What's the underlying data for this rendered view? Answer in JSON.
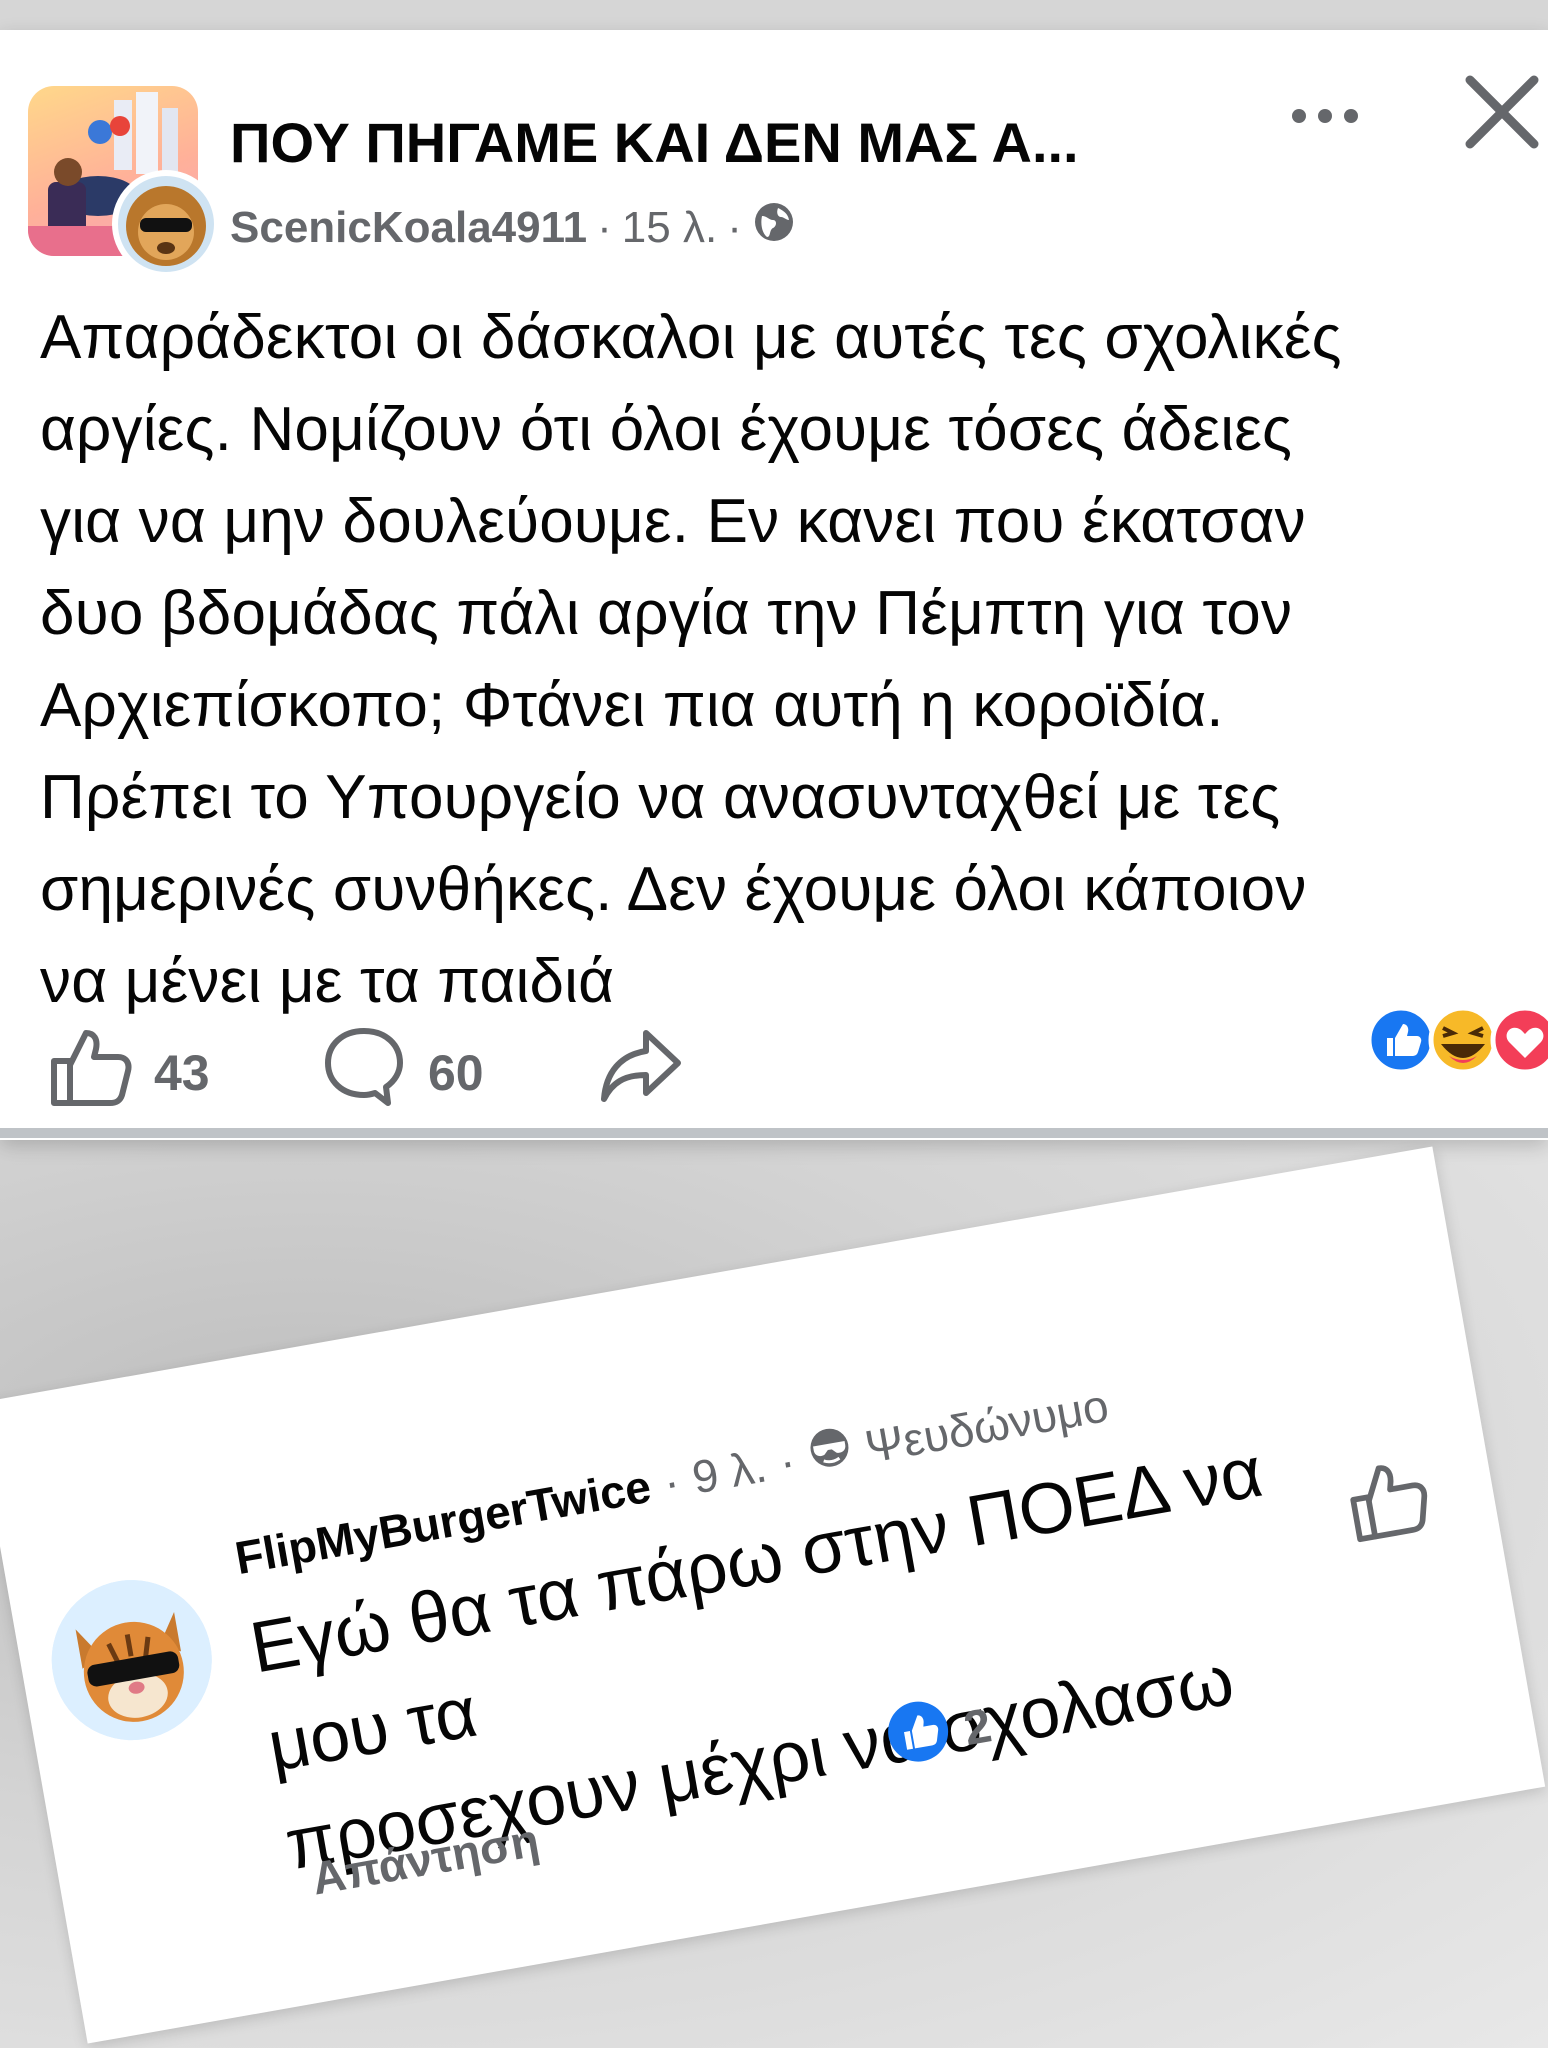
{
  "post": {
    "group_title": "ΠΟΥ ΠΗΓΑΜΕ ΚΑΙ ΔΕΝ ΜΑΣ Α...",
    "author": "ScenicKoala4911",
    "separator": "·",
    "time": "15 λ.",
    "privacy_icon": "globe-icon",
    "body_lines": [
      "Απαράδεκτοι οι δάσκαλοι με  αυτές τες σχολικές",
      "αργίες. Νομίζουν ότι όλοι έχουμε τόσες άδειες",
      "για να μην δουλεύουμε. Εν κανει που έκατσαν",
      "δυο βδομάδας πάλι αργία την Πέμπτη για τον",
      "Αρχιεπίσκοπο; Φτάνει πια αυτή η κοροϊδία.",
      "Πρέπει το Υπουργείο να ανασυνταχθεί με τες",
      "σημερινές συνθήκες. Δεν έχουμε όλοι κάποιον",
      "να μένει με τα παιδιά"
    ],
    "likes": "43",
    "comments": "60",
    "reaction_icons": [
      "like-icon",
      "haha-icon",
      "love-icon"
    ],
    "colors": {
      "like_blue": "#1877f2",
      "haha_yellow": "#f7b928",
      "love_red": "#f33e58",
      "meta_gray": "#65676b"
    }
  },
  "comment": {
    "author": "FlipMyBurgerTwice",
    "separator": "·",
    "time": "9 λ.",
    "badge_icon": "sunglasses-icon",
    "badge_label": "Ψευδώνυμο",
    "text_lines": [
      "Εγώ θα τα πάρω στην ΠΟΕΔ να μου τα",
      "προσεχουν μέχρι να σχολασω"
    ],
    "reaction_count": "2",
    "reply_label": "Απάντηση"
  }
}
